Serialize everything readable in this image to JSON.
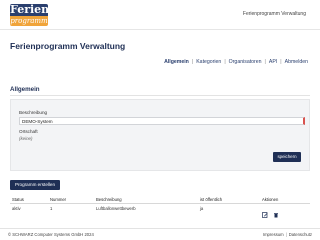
{
  "header": {
    "logo_line1": "Ferien",
    "logo_line2": "programm",
    "app_name": "Ferienprogramm Verwaltung"
  },
  "page_title": "Ferienprogramm Verwaltung",
  "tabs": [
    {
      "label": "Allgemein",
      "active": true
    },
    {
      "label": "Kategorien",
      "active": false
    },
    {
      "label": "Organisatoren",
      "active": false
    },
    {
      "label": "API",
      "active": false
    },
    {
      "label": "Abmelden",
      "active": false
    }
  ],
  "tab_separator": "|",
  "section_title": "Allgemein",
  "form": {
    "description_label": "Beschreibung",
    "description_value": "DEMO-System",
    "place_label": "Ortschaft",
    "place_value": "(keine)",
    "save_button": "speichern"
  },
  "create_program_button": "Programm erstellen",
  "table": {
    "columns": [
      "Status",
      "Nummer",
      "Beschreibung",
      "ist öffentlich",
      "Aktionen"
    ],
    "rows": [
      {
        "status": "aktiv",
        "number": "1",
        "description": "Luftballonwettbewerb",
        "public": "ja"
      }
    ]
  },
  "footer": {
    "copyright": "© SCHWARZ Computer Systems GmbH 2024",
    "links": [
      "Impressum",
      "Datenschutz"
    ],
    "separator": "|"
  },
  "colors": {
    "primary": "#1f2f55",
    "accent": "#f0a43a",
    "error_marker": "#d9534f"
  },
  "icons": {
    "edit": "edit-icon",
    "delete": "trash-icon"
  }
}
